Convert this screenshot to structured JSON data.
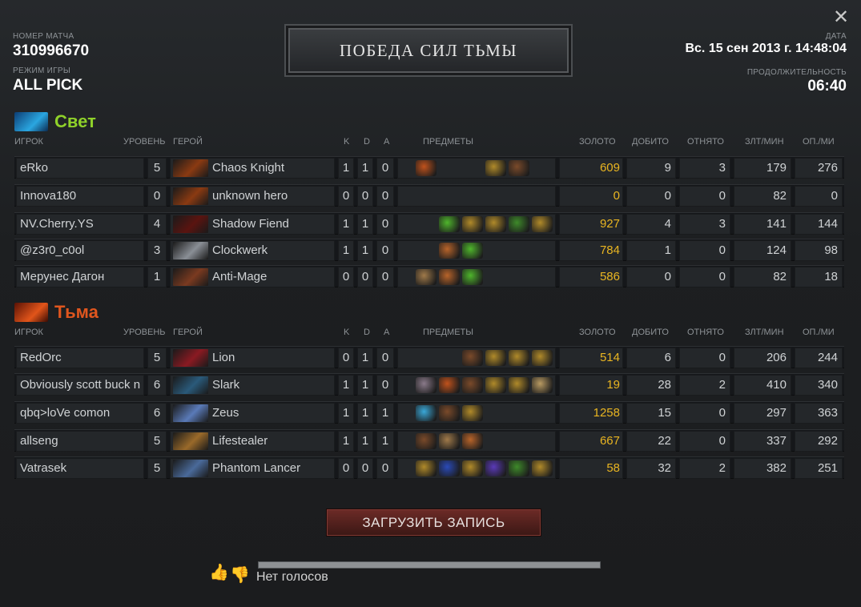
{
  "window": {
    "close_label": "✕"
  },
  "header": {
    "match_id_label": "НОМЕР МАТЧА",
    "match_id": "310996670",
    "mode_label": "РЕЖИМ ИГРЫ",
    "mode": "ALL PICK",
    "date_label": "ДАТА",
    "date": "Вс. 15 сен 2013 г. 14:48:04",
    "duration_label": "ПРОДОЛЖИТЕЛЬНОСТЬ",
    "duration": "06:40",
    "winner": "ПОБЕДА СИЛ ТЬМЫ"
  },
  "columns": {
    "player": "ИГРОК",
    "level": "УРОВЕНЬ",
    "hero": "ГЕРОЙ",
    "k": "K",
    "d": "D",
    "a": "A",
    "items": "ПРЕДМЕТЫ",
    "gold": "ЗОЛОТО",
    "last_hits": "ДОБИТО",
    "denies": "ОТНЯТО",
    "gpm": "ЗЛТ/МИН",
    "xpm": "ОП./МИ"
  },
  "radiant": {
    "name": "Свет",
    "color": "#8fd12a",
    "players": [
      {
        "name": "eRko",
        "level": "5",
        "hero": "Chaos Knight",
        "hero_color": "#8a3a12",
        "k": "1",
        "d": "1",
        "a": "0",
        "items": [
          {
            "icon": "helm-of-iron-will-icon",
            "color": "#c0521c",
            "slot": 0
          },
          {
            "icon": "gauntlets-icon",
            "color": "#b08a2a",
            "slot": 3
          },
          {
            "icon": "boots-icon",
            "color": "#7a4a2a",
            "slot": 4
          }
        ],
        "gold": "609",
        "last_hits": "9",
        "denies": "3",
        "gpm": "179",
        "xpm": "276"
      },
      {
        "name": "Innova180",
        "level": "0",
        "hero": "unknown hero",
        "hero_color": "#8a3a12",
        "k": "0",
        "d": "0",
        "a": "0",
        "items": [],
        "gold": "0",
        "last_hits": "0",
        "denies": "0",
        "gpm": "82",
        "xpm": "0"
      },
      {
        "name": "NV.Cherry.YS",
        "level": "4",
        "hero": "Shadow Fiend",
        "hero_color": "#5a1410",
        "k": "1",
        "d": "1",
        "a": "0",
        "items": [
          {
            "icon": "tango-icon",
            "color": "#4fb52c",
            "slot": 1
          },
          {
            "icon": "gauntlets-icon",
            "color": "#b08a2a",
            "slot": 2
          },
          {
            "icon": "gauntlets-icon",
            "color": "#b08a2a",
            "slot": 3
          },
          {
            "icon": "quelling-blade-icon",
            "color": "#3e8a2a",
            "slot": 4
          },
          {
            "icon": "gauntlets-icon",
            "color": "#b08a2a",
            "slot": 5
          }
        ],
        "gold": "927",
        "last_hits": "4",
        "denies": "3",
        "gpm": "141",
        "xpm": "144"
      },
      {
        "name": "@z3r0_c0ol",
        "level": "3",
        "hero": "Clockwerk",
        "hero_color": "#8a8f96",
        "k": "1",
        "d": "1",
        "a": "0",
        "items": [
          {
            "icon": "stout-shield-icon",
            "color": "#b8642a",
            "slot": 1
          },
          {
            "icon": "tango-icon",
            "color": "#4fb52c",
            "slot": 2
          }
        ],
        "gold": "784",
        "last_hits": "1",
        "denies": "0",
        "gpm": "124",
        "xpm": "98"
      },
      {
        "name": "Мерунес Дагон",
        "level": "1",
        "hero": "Anti-Mage",
        "hero_color": "#7a3a20",
        "k": "0",
        "d": "0",
        "a": "0",
        "items": [
          {
            "icon": "quelling-blade-icon",
            "color": "#a07a4a",
            "slot": 0
          },
          {
            "icon": "stout-shield-icon",
            "color": "#b8642a",
            "slot": 1
          },
          {
            "icon": "tango-icon",
            "color": "#4fb52c",
            "slot": 2
          }
        ],
        "gold": "586",
        "last_hits": "0",
        "denies": "0",
        "gpm": "82",
        "xpm": "18"
      }
    ]
  },
  "dire": {
    "name": "Тьма",
    "color": "#e0561e",
    "players": [
      {
        "name": "RedOrc",
        "level": "5",
        "hero": "Lion",
        "hero_color": "#8a1a22",
        "k": "0",
        "d": "1",
        "a": "0",
        "items": [
          {
            "icon": "boots-icon",
            "color": "#7a4a2a",
            "slot": 2
          },
          {
            "icon": "gauntlets-icon",
            "color": "#b08a2a",
            "slot": 3
          },
          {
            "icon": "gauntlets-icon",
            "color": "#b08a2a",
            "slot": 4
          },
          {
            "icon": "gauntlets-icon",
            "color": "#b08a2a",
            "slot": 5
          }
        ],
        "gold": "514",
        "last_hits": "6",
        "denies": "0",
        "gpm": "206",
        "xpm": "244"
      },
      {
        "name": "Obviously scott buck n",
        "level": "6",
        "hero": "Slark",
        "hero_color": "#2a5a7a",
        "k": "1",
        "d": "1",
        "a": "0",
        "items": [
          {
            "icon": "orb-icon",
            "color": "#8a7a8a",
            "slot": 0
          },
          {
            "icon": "helm-of-iron-will-icon",
            "color": "#c0521c",
            "slot": 1
          },
          {
            "icon": "boots-icon",
            "color": "#7a4a2a",
            "slot": 2
          },
          {
            "icon": "gauntlets-icon",
            "color": "#b08a2a",
            "slot": 3
          },
          {
            "icon": "gauntlets-icon",
            "color": "#b08a2a",
            "slot": 4
          },
          {
            "icon": "scroll-icon",
            "color": "#b89a62",
            "slot": 5
          }
        ],
        "gold": "19",
        "last_hits": "28",
        "denies": "2",
        "gpm": "410",
        "xpm": "340"
      },
      {
        "name": "qbq>loVe comon",
        "level": "6",
        "hero": "Zeus",
        "hero_color": "#5a7ab8",
        "k": "1",
        "d": "1",
        "a": "1",
        "items": [
          {
            "icon": "clarity-icon",
            "color": "#3aa8d8",
            "slot": 0
          },
          {
            "icon": "boots-icon",
            "color": "#7a4a2a",
            "slot": 1
          },
          {
            "icon": "gauntlets-icon",
            "color": "#b08a2a",
            "slot": 2
          }
        ],
        "gold": "1258",
        "last_hits": "15",
        "denies": "0",
        "gpm": "297",
        "xpm": "363"
      },
      {
        "name": "allseng",
        "level": "5",
        "hero": "Lifestealer",
        "hero_color": "#9a6a2a",
        "k": "1",
        "d": "1",
        "a": "1",
        "items": [
          {
            "icon": "boots-icon",
            "color": "#7a4a2a",
            "slot": 0
          },
          {
            "icon": "quelling-blade-icon",
            "color": "#a07a4a",
            "slot": 1
          },
          {
            "icon": "stout-shield-icon",
            "color": "#b8642a",
            "slot": 2
          }
        ],
        "gold": "667",
        "last_hits": "22",
        "denies": "0",
        "gpm": "337",
        "xpm": "292"
      },
      {
        "name": "Vatrasek",
        "level": "5",
        "hero": "Phantom Lancer",
        "hero_color": "#4a6a9a",
        "k": "0",
        "d": "0",
        "a": "0",
        "items": [
          {
            "icon": "gauntlets-icon",
            "color": "#b08a2a",
            "slot": 0
          },
          {
            "icon": "ring-icon",
            "color": "#2a4ab8",
            "slot": 1
          },
          {
            "icon": "gauntlets-icon",
            "color": "#b08a2a",
            "slot": 2
          },
          {
            "icon": "ring-icon",
            "color": "#5a3ab8",
            "slot": 3
          },
          {
            "icon": "quelling-blade-icon",
            "color": "#3e8a2a",
            "slot": 4
          },
          {
            "icon": "gauntlets-icon",
            "color": "#b08a2a",
            "slot": 5
          }
        ],
        "gold": "58",
        "last_hits": "32",
        "denies": "2",
        "gpm": "382",
        "xpm": "251"
      }
    ]
  },
  "footer": {
    "download_label": "ЗАГРУЗИТЬ ЗАПИСЬ",
    "votes_text": "Нет голосов",
    "thumbs_up": "👍",
    "thumbs_down": "👍"
  }
}
